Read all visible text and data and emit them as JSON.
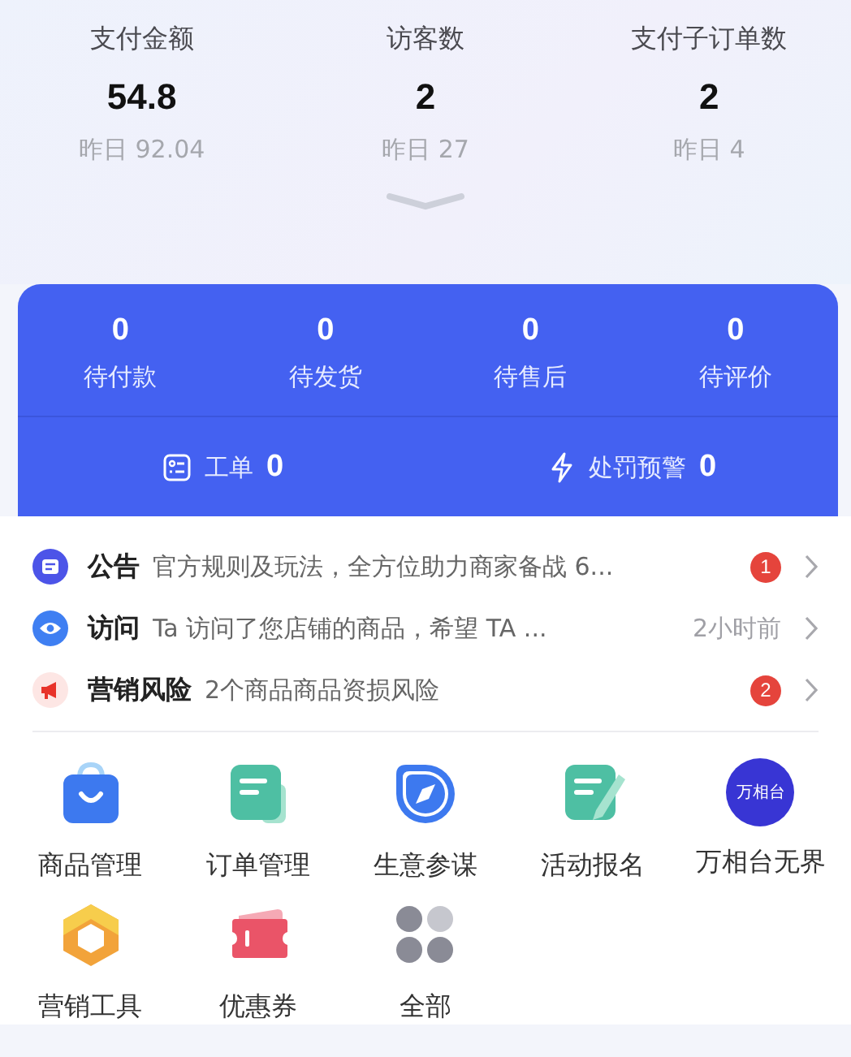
{
  "stats": [
    {
      "label": "支付金额",
      "value": "54.8",
      "yesterday": "昨日 92.04"
    },
    {
      "label": "访客数",
      "value": "2",
      "yesterday": "昨日 27"
    },
    {
      "label": "支付子订单数",
      "value": "2",
      "yesterday": "昨日 4"
    }
  ],
  "orders": [
    {
      "count": "0",
      "label": "待付款"
    },
    {
      "count": "0",
      "label": "待发货"
    },
    {
      "count": "0",
      "label": "待售后"
    },
    {
      "count": "0",
      "label": "待评价"
    }
  ],
  "alerts": [
    {
      "kind": "ticket",
      "label": "工单",
      "count": "0"
    },
    {
      "kind": "warning",
      "label": "处罚预警",
      "count": "0"
    }
  ],
  "notices": [
    {
      "kind": "announcement",
      "title": "公告",
      "text": "官方规则及玩法，全方位助力商家备战 6...",
      "badge": "1"
    },
    {
      "kind": "visit",
      "title": "访问",
      "text": "Ta 访问了您店铺的商品，希望 TA ...",
      "time": "2小时前"
    },
    {
      "kind": "risk",
      "title": "营销风险",
      "text": "2个商品商品资损风险",
      "badge": "2"
    }
  ],
  "tools": [
    {
      "kind": "bag",
      "label": "商品管理"
    },
    {
      "kind": "order",
      "label": "订单管理"
    },
    {
      "kind": "compass",
      "label": "生意参谋"
    },
    {
      "kind": "signup",
      "label": "活动报名"
    },
    {
      "kind": "logo",
      "label": "万相台无界",
      "logo_text": "万相台"
    },
    {
      "kind": "hexagon",
      "label": "营销工具"
    },
    {
      "kind": "coupon",
      "label": "优惠券"
    },
    {
      "kind": "all",
      "label": "全部"
    }
  ]
}
